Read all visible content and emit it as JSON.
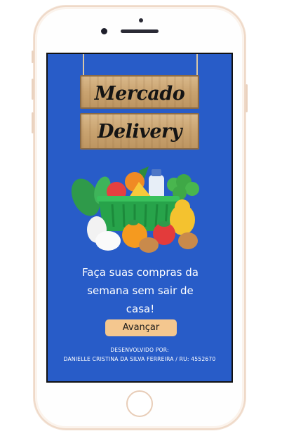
{
  "app": {
    "sign_line1": "Mercado",
    "sign_line2": "Delivery"
  },
  "main": {
    "tagline_line1": "Faça suas compras da",
    "tagline_line2": "semana sem sair de",
    "tagline_line3": "casa!",
    "advance_button_label": "Avançar"
  },
  "footer": {
    "developed_by_label": "DESENVOLVIDO POR:",
    "developer_info": "DANIELLE CRISTINA DA SILVA FERREIRA / RU: 4552670"
  },
  "colors": {
    "screen_background": "#285cc8",
    "button_background": "#f4c78f",
    "sign_wood": "#c9a370"
  },
  "icons": [
    "grocery-basket-illustration"
  ]
}
